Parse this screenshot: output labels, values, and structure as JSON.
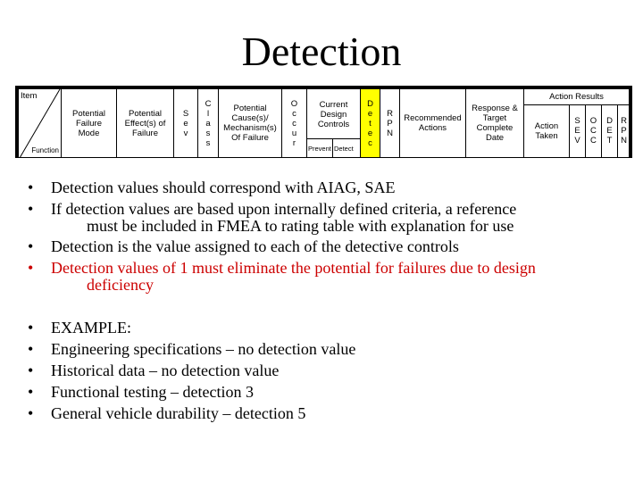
{
  "title": "Detection",
  "fmea_header": {
    "item": "Item",
    "function": "Function",
    "potential_failure_mode": [
      "Potential",
      "Failure",
      "Mode"
    ],
    "potential_effects": [
      "Potential",
      "Effect(s) of",
      "Failure"
    ],
    "sev": [
      "S",
      "e",
      "v"
    ],
    "class": [
      "C",
      "l",
      "a",
      "s",
      "s"
    ],
    "potential_cause": [
      "Potential",
      "Cause(s)/",
      "Mechanism(s)",
      "Of Failure"
    ],
    "occur": [
      "O",
      "c",
      "c",
      "u",
      "r"
    ],
    "current_design_controls": [
      "Current",
      "Design",
      "Controls"
    ],
    "prevent": "Prevent",
    "detect": "Detect",
    "detec": [
      "D",
      "e",
      "t",
      "e",
      "c"
    ],
    "rpn": [
      "R",
      "P",
      "N"
    ],
    "recommended_actions": [
      "Recommended",
      "Actions"
    ],
    "response_target": [
      "Response &",
      "Target",
      "Complete",
      "Date"
    ],
    "action_results": "Action Results",
    "action_taken": [
      "Action",
      "Taken"
    ],
    "res_sev": [
      "S",
      "E",
      "V"
    ],
    "res_occ": [
      "O",
      "C",
      "C"
    ],
    "res_det": [
      "D",
      "E",
      "T"
    ],
    "res_rpn": [
      "R",
      "P",
      "N"
    ],
    "highlight_color": "#ffff00"
  },
  "bullets_group1": [
    {
      "lines": [
        "Detection values should correspond with AIAG, SAE"
      ],
      "color": "#000000"
    },
    {
      "lines": [
        "If detection values are based upon internally defined criteria, a reference",
        "must be included in FMEA to rating table with explanation for use"
      ],
      "color": "#000000"
    },
    {
      "lines": [
        "Detection is the value assigned to each of the detective controls"
      ],
      "color": "#000000"
    },
    {
      "lines": [
        "Detection values of 1 must eliminate the potential for failures due to design",
        "deficiency"
      ],
      "color": "#cc0000"
    }
  ],
  "bullets_group2": [
    {
      "lines": [
        "EXAMPLE:"
      ]
    },
    {
      "lines": [
        "Engineering specifications – no detection value"
      ]
    },
    {
      "lines": [
        "Historical data –  no detection value"
      ]
    },
    {
      "lines": [
        "Functional testing – detection 3"
      ]
    },
    {
      "lines": [
        "General vehicle durability – detection 5"
      ]
    }
  ],
  "bullet_symbol": "•"
}
